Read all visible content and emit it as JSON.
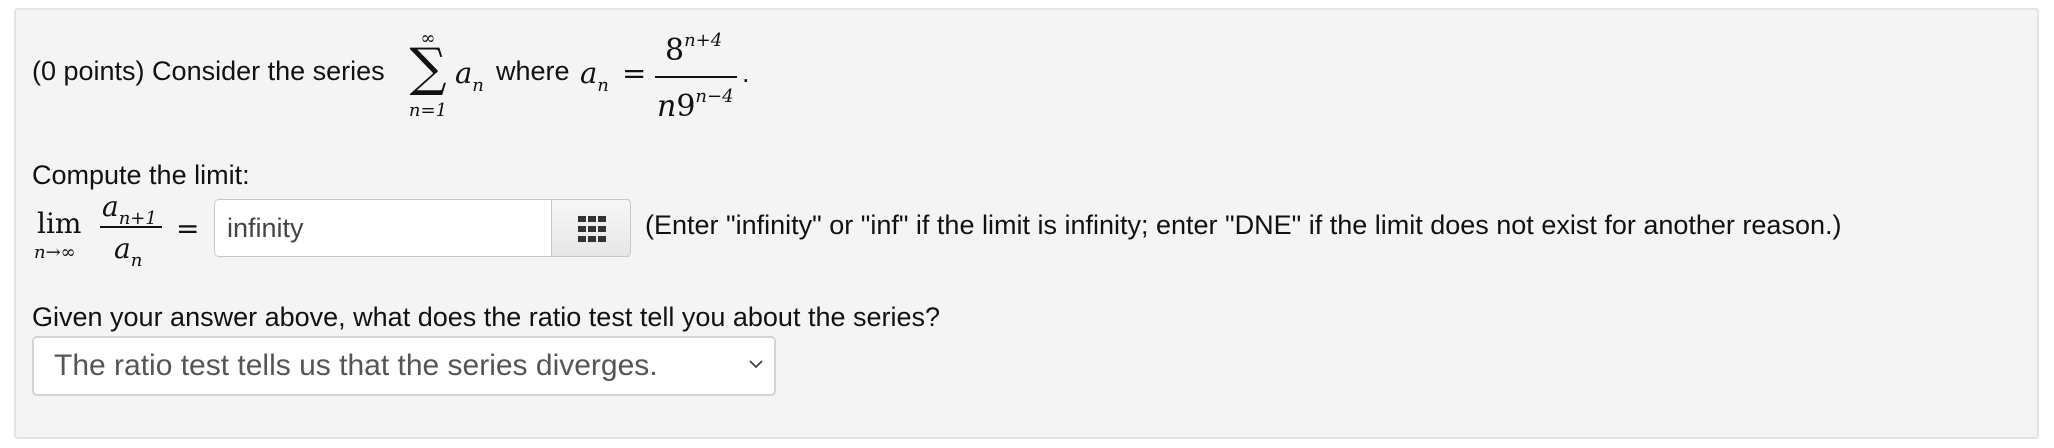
{
  "question": {
    "intro": "(0 points) Consider the series",
    "sum_upper": "∞",
    "sum_symbol": "∑",
    "sum_lower": "n=1",
    "term": "a",
    "term_sub": "n",
    "where": "where",
    "eq": "=",
    "numerator_base": "8",
    "numerator_exp": "n+4",
    "denominator_n": "n",
    "denominator_base": "9",
    "denominator_exp": "n−4",
    "period": "."
  },
  "limit_part": {
    "prompt": "Compute the limit:",
    "lim": "lim",
    "lim_sub": "n→∞",
    "num_term": "a",
    "num_sub": "n+1",
    "den_term": "a",
    "den_sub": "n",
    "eq": "=",
    "answer_value": "infinity",
    "palette_icon": "grid-icon",
    "hint": "(Enter \"infinity\" or \"inf\" if the limit is infinity; enter \"DNE\" if the limit does not exist for another reason.)"
  },
  "ratio_part": {
    "prompt": "Given your answer above, what does the ratio test tell you about the series?",
    "selected_option": "The ratio test tells us that the series diverges.",
    "caret_icon": "chevron-down-icon"
  }
}
